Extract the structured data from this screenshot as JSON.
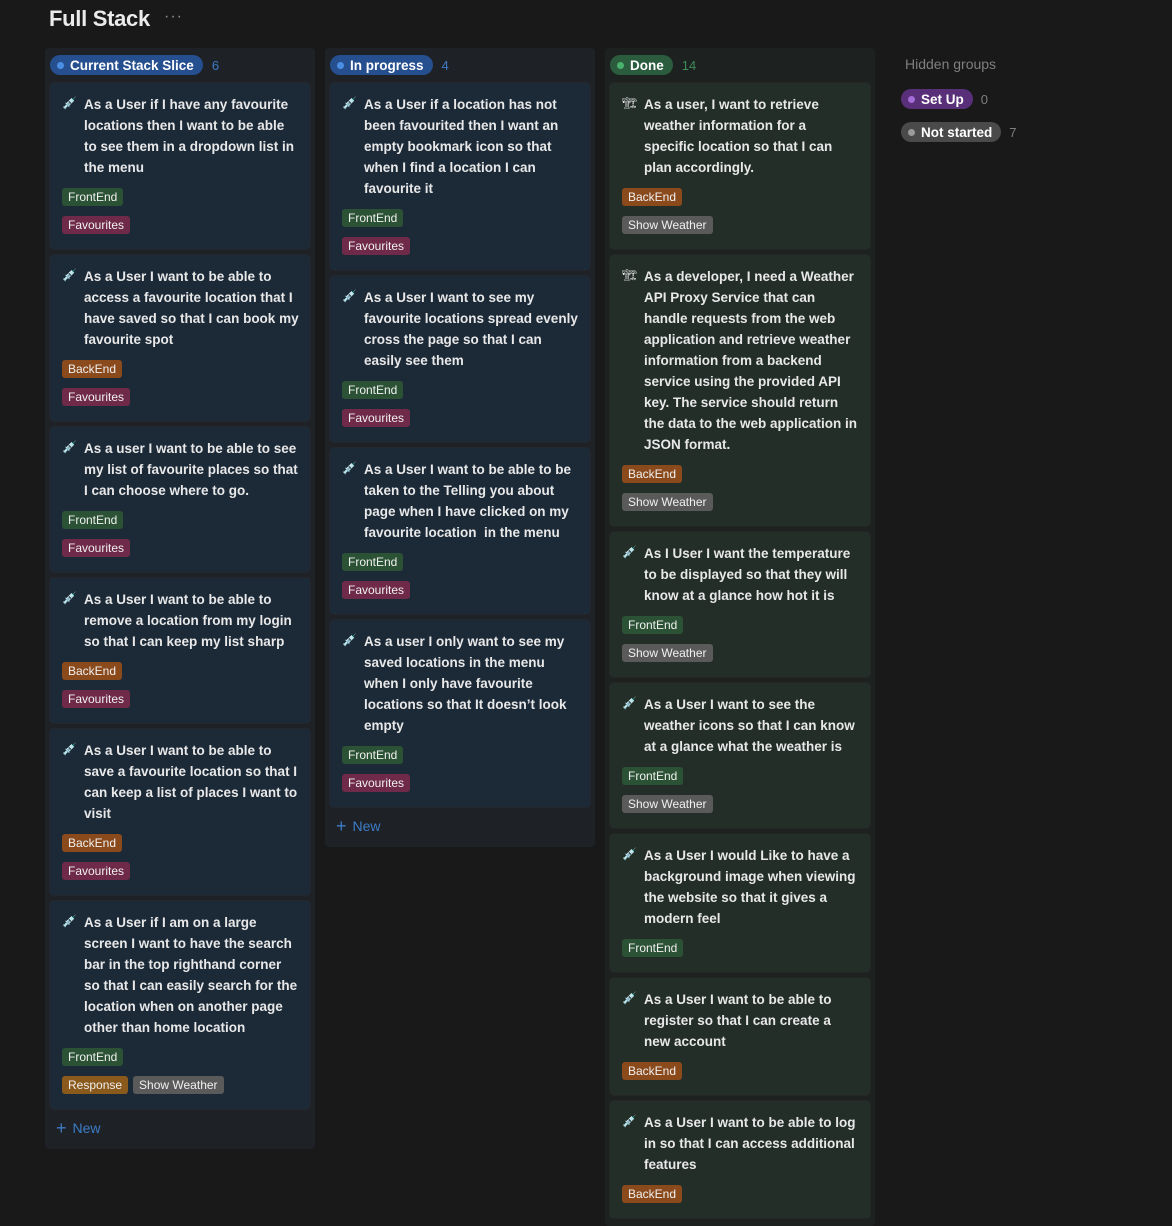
{
  "board": {
    "title": "Full Stack",
    "more_icon": "ellipsis-icon",
    "more_label": "···"
  },
  "colors": {
    "current_pill": "#264f8f",
    "current_dot": "#4b8fe3",
    "current_col": "#1e2126",
    "current_card": "#1c2a38",
    "current_count": "#3d7cc7",
    "progress_pill": "#264f8f",
    "progress_dot": "#4b8fe3",
    "progress_col": "#1e2126",
    "progress_card": "#1c2a38",
    "progress_count": "#3d7cc7",
    "done_pill": "#2b5c3e",
    "done_dot": "#4cb16d",
    "done_col": "#1d211f",
    "done_card": "#232e29",
    "done_count": "#3f8b5a",
    "tag_frontend": "#2b5234",
    "tag_backend": "#8a4a1c",
    "tag_favourites": "#6e2a48",
    "tag_showweather": "#5a5a5a",
    "tag_response": "#8a5a1c"
  },
  "columns": [
    {
      "label": "Current Stack Slice",
      "count": "6",
      "new_label": "New",
      "cards": [
        {
          "icon": "syringe-icon",
          "icon_glyph": "💉",
          "text": "As a User if I have any favourite locations then I want to be able to see them in a dropdown list in the menu",
          "tags": [
            [
              "FrontEnd"
            ],
            [
              "Favourites"
            ]
          ]
        },
        {
          "icon": "syringe-icon",
          "icon_glyph": "💉",
          "text": "As a User I want to be able to access a favourite location that I have saved so that I can book my favourite spot",
          "tags": [
            [
              "BackEnd"
            ],
            [
              "Favourites"
            ]
          ]
        },
        {
          "icon": "syringe-icon",
          "icon_glyph": "💉",
          "text": "As a user I want to be able to see my list of favourite places so that I can choose where to go.",
          "tags": [
            [
              "FrontEnd"
            ],
            [
              "Favourites"
            ]
          ]
        },
        {
          "icon": "syringe-icon",
          "icon_glyph": "💉",
          "text": "As a User I want to be able to remove a location from my login so that I can keep my list sharp",
          "tags": [
            [
              "BackEnd"
            ],
            [
              "Favourites"
            ]
          ]
        },
        {
          "icon": "syringe-icon",
          "icon_glyph": "💉",
          "text": "As a User I want to be able to save a favourite location so that I can keep a list of places I want to visit",
          "tags": [
            [
              "BackEnd"
            ],
            [
              "Favourites"
            ]
          ]
        },
        {
          "icon": "syringe-icon",
          "icon_glyph": "💉",
          "text": "As a User if I am on a large screen I want to have the search bar in the top righthand corner so that I can easily search for the location when on another page other than home location",
          "tags": [
            [
              "FrontEnd"
            ],
            [
              "Response",
              "Show Weather"
            ]
          ]
        }
      ]
    },
    {
      "label": "In progress",
      "count": "4",
      "new_label": "New",
      "cards": [
        {
          "icon": "syringe-icon",
          "icon_glyph": "💉",
          "text": "As a User if a location has not been favourited then I want an empty bookmark icon so that when I find a location I can favourite it",
          "tags": [
            [
              "FrontEnd"
            ],
            [
              "Favourites"
            ]
          ]
        },
        {
          "icon": "syringe-icon",
          "icon_glyph": "💉",
          "text": "As a User I want to see my favourite locations spread evenly cross the page so that I can easily see them",
          "tags": [
            [
              "FrontEnd"
            ],
            [
              "Favourites"
            ]
          ]
        },
        {
          "icon": "syringe-icon",
          "icon_glyph": "💉",
          "text": "As a User I want to be able to be taken to the Telling you about page when I have clicked on my favourite location  in the menu",
          "tags": [
            [
              "FrontEnd"
            ],
            [
              "Favourites"
            ]
          ]
        },
        {
          "icon": "syringe-icon",
          "icon_glyph": "💉",
          "text": "As a user I only want to see my saved locations in the menu when I only have favourite locations so that It doesn’t look empty",
          "tags": [
            [
              "FrontEnd"
            ],
            [
              "Favourites"
            ]
          ]
        }
      ]
    },
    {
      "label": "Done",
      "count": "14",
      "cards": [
        {
          "icon": "construction-crane-icon",
          "icon_glyph": "🏗",
          "text": "As a user, I want to retrieve weather information for a specific location so that I can plan accordingly.",
          "tags": [
            [
              "BackEnd"
            ],
            [
              "Show Weather"
            ]
          ]
        },
        {
          "icon": "construction-crane-icon",
          "icon_glyph": "🏗",
          "text": "As a developer, I need a Weather API Proxy Service that can handle requests from the web application and retrieve weather information from a backend service using the provided API key. The service should return the data to the web application in JSON format.",
          "tags": [
            [
              "BackEnd"
            ],
            [
              "Show Weather"
            ]
          ]
        },
        {
          "icon": "syringe-icon",
          "icon_glyph": "💉",
          "text": "As I User I want the temperature to be displayed so that they will know at a glance how hot it is",
          "tags": [
            [
              "FrontEnd"
            ],
            [
              "Show Weather"
            ]
          ]
        },
        {
          "icon": "syringe-icon",
          "icon_glyph": "💉",
          "text": "As a User I want to see the weather icons so that I can know at a glance what the weather is",
          "tags": [
            [
              "FrontEnd"
            ],
            [
              "Show Weather"
            ]
          ]
        },
        {
          "icon": "syringe-icon",
          "icon_glyph": "💉",
          "text": "As a User I would Like to have a background image when viewing the website so that it gives a modern feel",
          "tags": [
            [
              "FrontEnd"
            ]
          ]
        },
        {
          "icon": "syringe-icon",
          "icon_glyph": "💉",
          "text": "As a User I want to be able to register so that I can create a new account",
          "tags": [
            [
              "BackEnd"
            ]
          ]
        },
        {
          "icon": "syringe-icon",
          "icon_glyph": "💉",
          "text": "As a User I want to be able to log in so that I can access additional features",
          "tags": [
            [
              "BackEnd"
            ]
          ]
        }
      ]
    }
  ],
  "hidden_groups": {
    "title": "Hidden groups",
    "items": [
      {
        "label": "Set Up",
        "count": "0",
        "pill": "#5a2f7a",
        "dot": "#a46cd6"
      },
      {
        "label": "Not started",
        "count": "7",
        "pill": "#4a4a4a",
        "dot": "#9a9a9a"
      }
    ]
  }
}
